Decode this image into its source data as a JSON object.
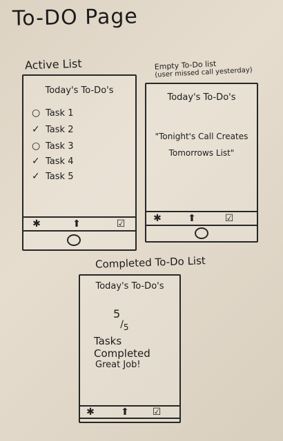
{
  "page": {
    "title": "To-DO Page"
  },
  "active_screen": {
    "caption": "Active List",
    "header": "Today's To-Do's",
    "tasks": [
      {
        "label": "Task 1",
        "checked": false
      },
      {
        "label": "Task 2",
        "checked": true
      },
      {
        "label": "Task 3",
        "checked": false
      },
      {
        "label": "Task 4",
        "checked": true
      },
      {
        "label": "Task 5",
        "checked": true
      }
    ]
  },
  "empty_screen": {
    "caption_line1": "Empty To-Do list",
    "caption_line2": "(user missed call yesterday)",
    "header": "Today's To-Do's",
    "message_line1": "\"Tonight's Call Creates",
    "message_line2": "Tomorrows List\""
  },
  "completed_screen": {
    "caption": "Completed To-Do List",
    "header": "Today's To-Do's",
    "count_done": "5",
    "count_total": "5",
    "title": "Tasks Completed",
    "subtitle": "Great Job!"
  },
  "tabbar": {
    "icons": [
      "asterisk-icon",
      "up-arrow-icon",
      "checkbox-icon"
    ],
    "glyphs": [
      "✱",
      "⬆",
      "☑"
    ]
  }
}
